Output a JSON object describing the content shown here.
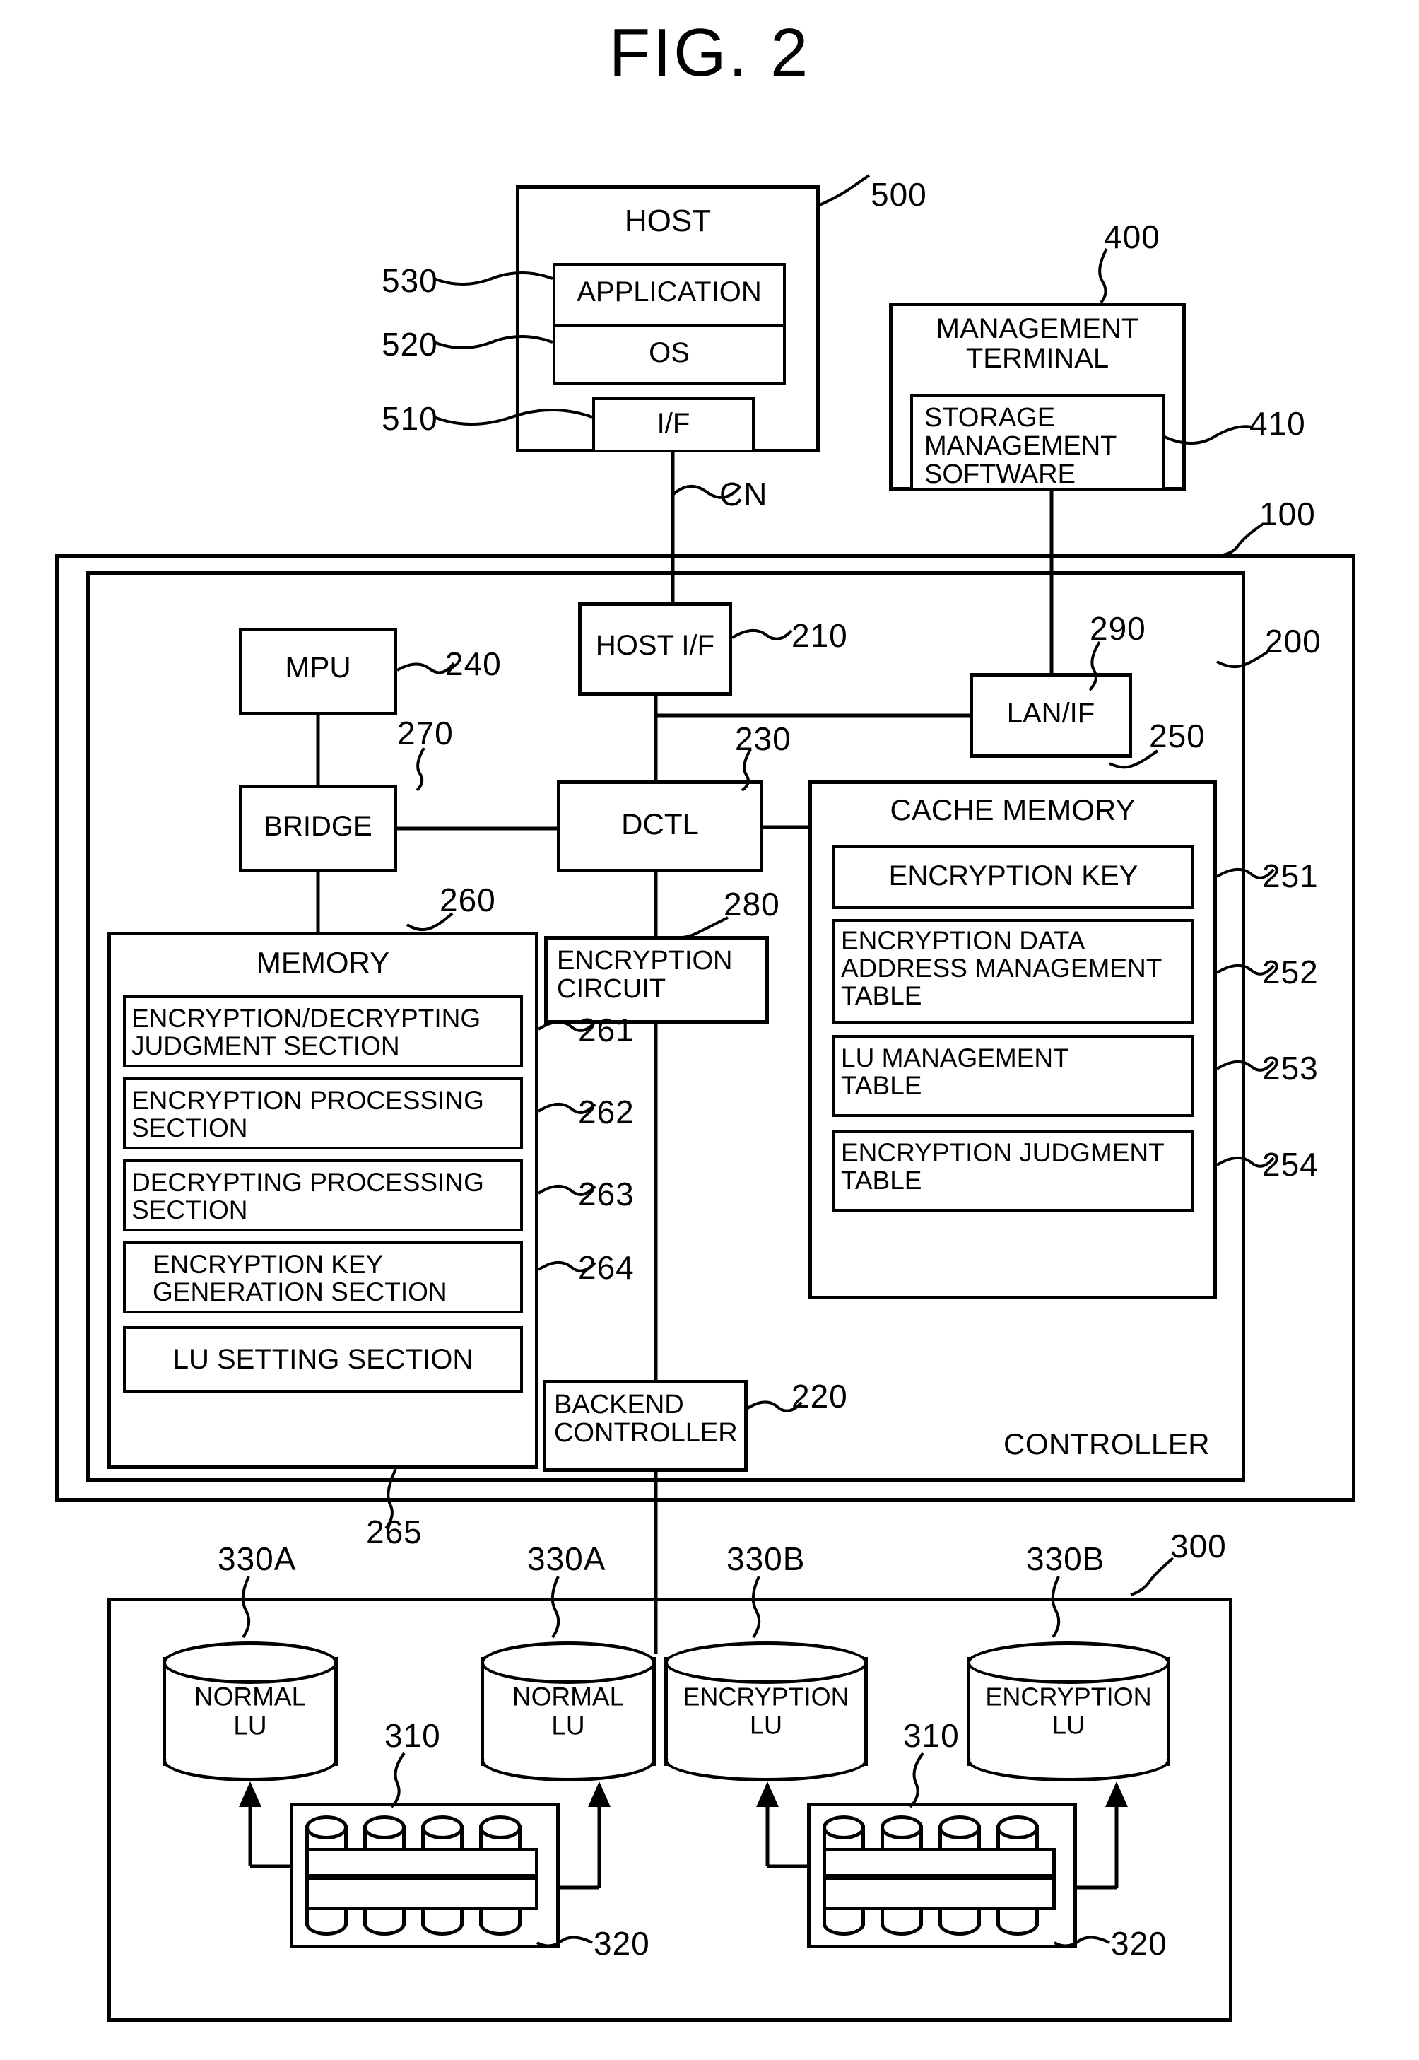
{
  "figure": {
    "title": "FIG. 2"
  },
  "host": {
    "title": "HOST",
    "ref": "500",
    "application": {
      "label": "APPLICATION",
      "ref": "530"
    },
    "os": {
      "label": "OS",
      "ref": "520"
    },
    "interface": {
      "label": "I/F",
      "ref": "510"
    }
  },
  "network": {
    "label": "CN"
  },
  "management_terminal": {
    "title": "MANAGEMENT\nTERMINAL",
    "ref": "400",
    "software": {
      "label": "STORAGE\nMANAGEMENT\nSOFTWARE",
      "ref": "410"
    }
  },
  "storage_system": {
    "ref": "100"
  },
  "controller": {
    "label": "CONTROLLER",
    "ref": "200",
    "host_if": {
      "label": "HOST I/F",
      "ref": "210"
    },
    "lan_if": {
      "label": "LAN/IF",
      "ref": "290"
    },
    "mpu": {
      "label": "MPU",
      "ref": "240"
    },
    "bridge": {
      "label": "BRIDGE",
      "ref": "270"
    },
    "dctl": {
      "label": "DCTL",
      "ref": "230"
    },
    "encryption_circuit": {
      "label": "ENCRYPTION\nCIRCUIT",
      "ref": "280"
    },
    "backend_controller": {
      "label": "BACKEND\nCONTROLLER",
      "ref": "220"
    }
  },
  "memory": {
    "title": "MEMORY",
    "ref": "260",
    "bus_ref": "265",
    "sections": [
      {
        "label": "ENCRYPTION/DECRYPTING\nJUDGMENT SECTION",
        "ref": "261",
        "align": "left"
      },
      {
        "label": "ENCRYPTION PROCESSING\nSECTION",
        "ref": "262",
        "align": "left"
      },
      {
        "label": "DECRYPTING PROCESSING\nSECTION",
        "ref": "263",
        "align": "left"
      },
      {
        "label": "ENCRYPTION KEY\nGENERATION SECTION",
        "ref": "264",
        "align": "center"
      },
      {
        "label": "LU SETTING SECTION",
        "ref": "",
        "align": "center"
      }
    ]
  },
  "cache_memory": {
    "title": "CACHE MEMORY",
    "ref": "250",
    "items": [
      {
        "label": "ENCRYPTION KEY",
        "ref": "251",
        "align": "center"
      },
      {
        "label": "ENCRYPTION DATA\nADDRESS MANAGEMENT\nTABLE",
        "ref": "252",
        "align": "left"
      },
      {
        "label": "LU MANAGEMENT\nTABLE",
        "ref": "253",
        "align": "left"
      },
      {
        "label": "ENCRYPTION JUDGMENT\nTABLE",
        "ref": "254",
        "align": "left"
      }
    ]
  },
  "storage_unit": {
    "ref": "300",
    "logical_units": [
      {
        "label": "NORMAL\nLU",
        "ref": "330A"
      },
      {
        "label": "NORMAL\nLU",
        "ref": "330A"
      },
      {
        "label": "ENCRYPTION\nLU",
        "ref": "330B"
      },
      {
        "label": "ENCRYPTION\nLU",
        "ref": "330B"
      }
    ],
    "disk_arrays": [
      {
        "disk_ref": "310",
        "array_ref": "320"
      },
      {
        "disk_ref": "310",
        "array_ref": "320"
      }
    ]
  },
  "colors": {
    "ink": "#000000",
    "paper": "#ffffff"
  }
}
